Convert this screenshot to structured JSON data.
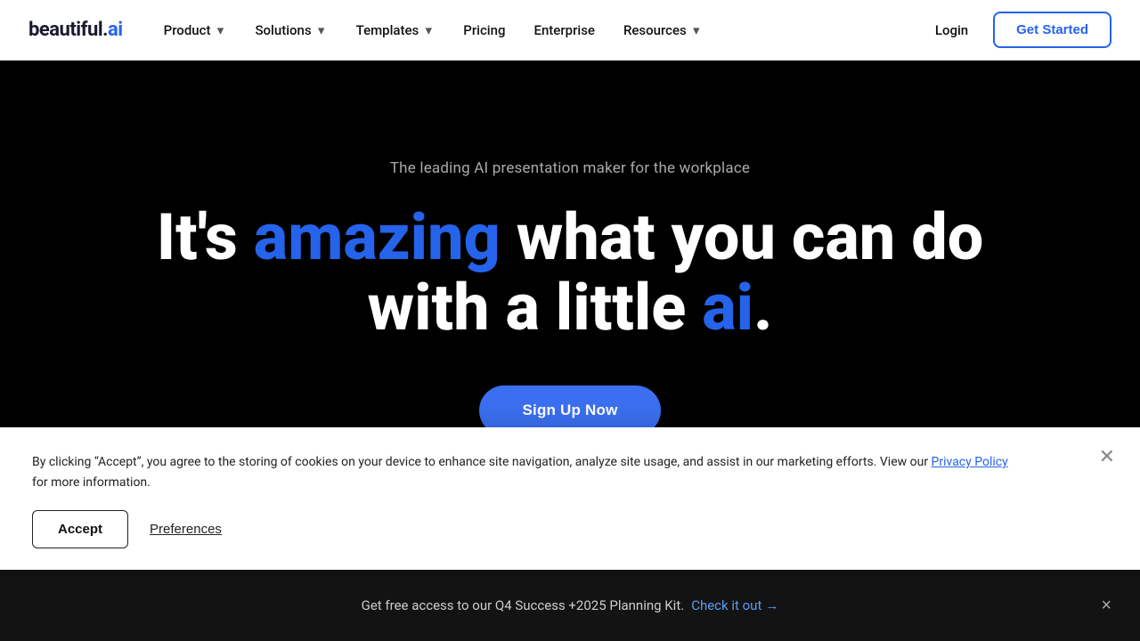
{
  "brand": {
    "name_start": "beautiful.",
    "name_end": "ai",
    "logo_text": "beautiful.ai"
  },
  "nav": {
    "items": [
      {
        "label": "Product",
        "has_dropdown": true
      },
      {
        "label": "Solutions",
        "has_dropdown": true
      },
      {
        "label": "Templates",
        "has_dropdown": true
      },
      {
        "label": "Pricing",
        "has_dropdown": false
      },
      {
        "label": "Enterprise",
        "has_dropdown": false
      },
      {
        "label": "Resources",
        "has_dropdown": true
      }
    ],
    "login_label": "Login",
    "get_started_label": "Get Started"
  },
  "hero": {
    "subtitle": "The leading AI presentation maker for the workplace",
    "headline_part1": "It's ",
    "headline_amazing": "amazing",
    "headline_part2": " what you can do",
    "headline_part3": "with a little ",
    "headline_ai": "ai",
    "headline_period": ".",
    "cta_label": "Sign Up Now"
  },
  "bottom_banner": {
    "text": "Get free access to our Q4 Success +2025 Planning Kit.",
    "link_label": "Check it out",
    "close_label": "×"
  },
  "cookie": {
    "text_start": "By clicking “Accept”, you agree to the storing of cookies on your device to enhance site navigation, analyze site usage, and assist in our marketing efforts. View our ",
    "privacy_policy_label": "Privacy Policy",
    "text_end": " for more information.",
    "accept_label": "Accept",
    "preferences_label": "Preferences"
  }
}
